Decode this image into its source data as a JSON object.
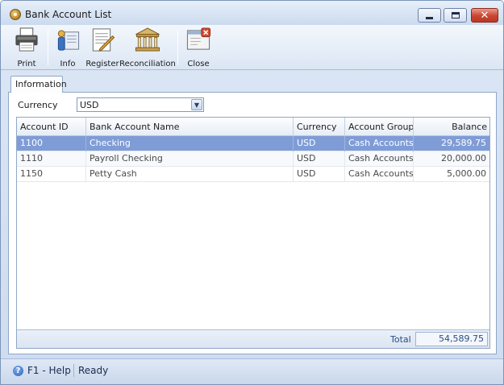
{
  "window": {
    "title": "Bank Account List"
  },
  "toolbar": {
    "buttons": [
      {
        "label": "Print",
        "icon": "printer-icon"
      },
      {
        "label": "Info",
        "icon": "info-icon"
      },
      {
        "label": "Register",
        "icon": "register-icon"
      },
      {
        "label": "Reconciliation",
        "icon": "bank-icon"
      },
      {
        "label": "Close",
        "icon": "close-icon"
      }
    ]
  },
  "tabs": [
    {
      "label": "Information",
      "selected": true
    }
  ],
  "filter": {
    "label": "Currency",
    "value": "USD"
  },
  "grid": {
    "columns": [
      "Account ID",
      "Bank Account Name",
      "Currency",
      "Account Group",
      "Balance"
    ],
    "rows": [
      {
        "account_id": "1100",
        "name": "Checking",
        "currency": "USD",
        "group": "Cash Accounts",
        "balance": "29,589.75",
        "selected": true
      },
      {
        "account_id": "1110",
        "name": "Payroll Checking",
        "currency": "USD",
        "group": "Cash Accounts",
        "balance": "20,000.00",
        "selected": false
      },
      {
        "account_id": "1150",
        "name": "Petty Cash",
        "currency": "USD",
        "group": "Cash Accounts",
        "balance": "5,000.00",
        "selected": false
      }
    ],
    "total_label": "Total",
    "total_value": "54,589.75"
  },
  "statusbar": {
    "help": "F1 - Help",
    "status": "Ready"
  },
  "colors": {
    "selected_row": "#7f9cd6",
    "close_button": "#c94530",
    "accent_text": "#2a4e86"
  }
}
